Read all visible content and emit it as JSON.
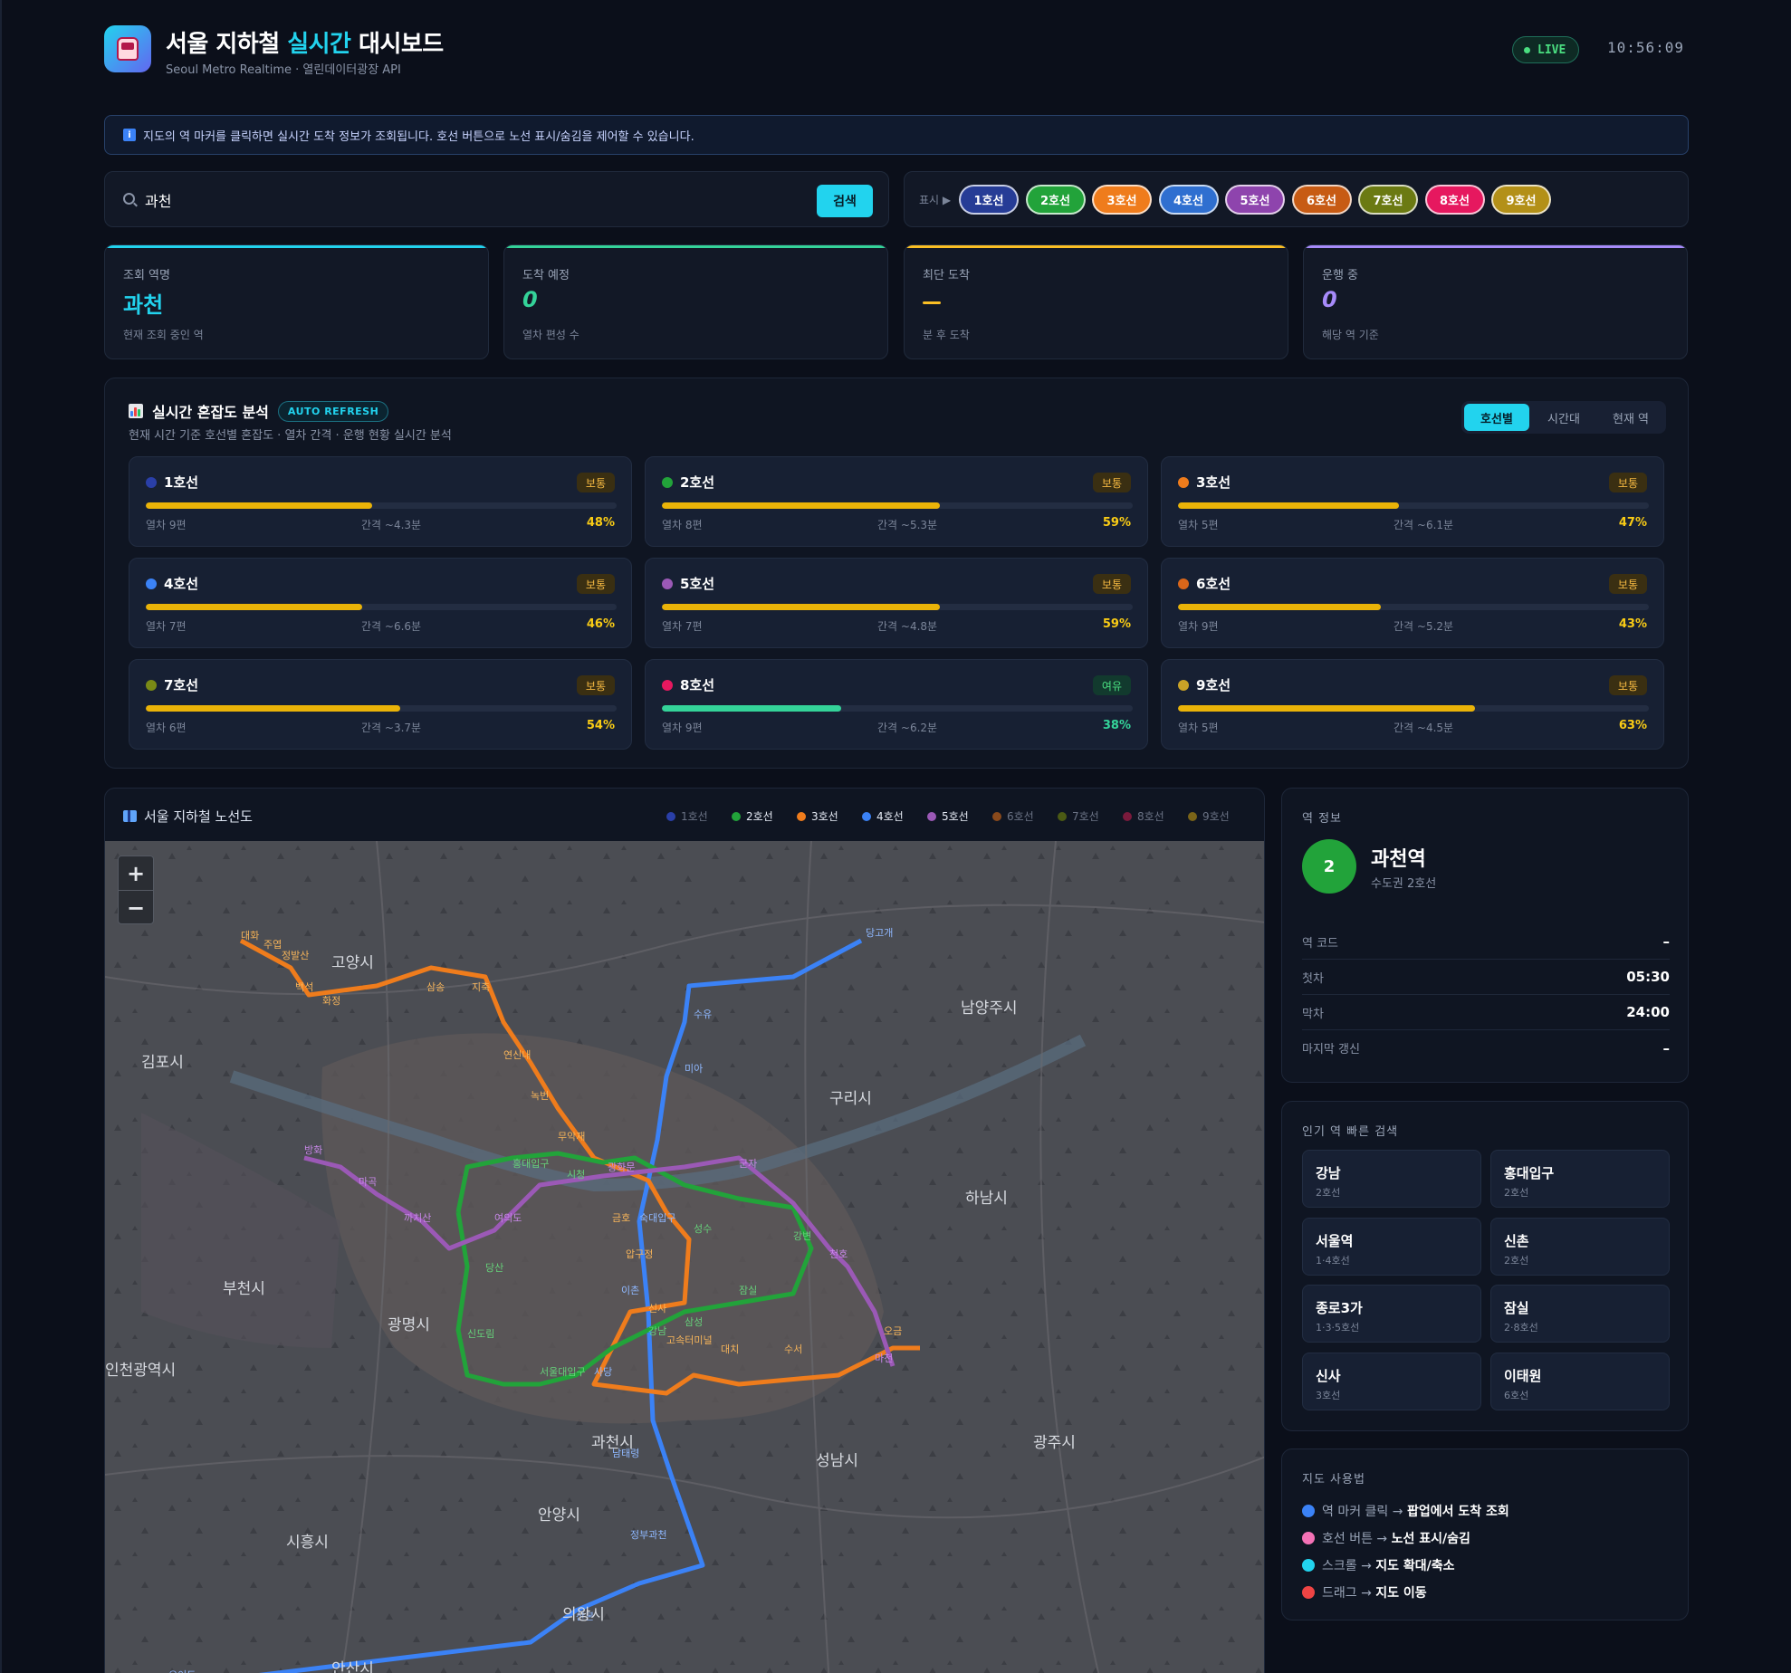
{
  "header": {
    "title_prefix": "서울 지하철 ",
    "title_accent": "실시간",
    "title_suffix": " 대시보드",
    "subtitle": "Seoul Metro Realtime · 열린데이터광장 API",
    "live": "LIVE",
    "clock": "10:56:09"
  },
  "notice": "지도의 역 마커를 클릭하면 실시간 도착 정보가 조회됩니다. 호선 버튼으로 노선 표시/숨김을 제어할 수 있습니다.",
  "search": {
    "value": "과천",
    "button": "검색"
  },
  "line_toggle": {
    "label": "표시 ▶",
    "lines": [
      {
        "label": "1호선",
        "color": "#263c96"
      },
      {
        "label": "2호선",
        "color": "#22a33a"
      },
      {
        "label": "3호선",
        "color": "#ef7c1c"
      },
      {
        "label": "4호선",
        "color": "#2f6fd0"
      },
      {
        "label": "5호선",
        "color": "#8e44ad"
      },
      {
        "label": "6호선",
        "color": "#c75b14"
      },
      {
        "label": "7호선",
        "color": "#6b7a12"
      },
      {
        "label": "8호선",
        "color": "#e6185f"
      },
      {
        "label": "9호선",
        "color": "#b39018"
      }
    ]
  },
  "stats": [
    {
      "label": "조회 역명",
      "value": "과천",
      "sub": "현재 조회 중인 역",
      "color": "#22d3ee"
    },
    {
      "label": "도착 예정",
      "value": "0",
      "sub": "열차 편성 수",
      "color": "#34d399"
    },
    {
      "label": "최단 도착",
      "value": "",
      "sub": "분 후 도착",
      "color": "#fbbf24"
    },
    {
      "label": "운행 중",
      "value": "0",
      "sub": "해당 역 기준",
      "color": "#a78bfa"
    }
  ],
  "congestion": {
    "title": "실시간 혼잡도 분석",
    "badge": "AUTO REFRESH",
    "subtitle": "현재 시간 기준 호선별 혼잡도 · 열차 간격 · 운행 현황 실시간 분석",
    "tabs": [
      "호선별",
      "시간대",
      "현재 역"
    ],
    "items": [
      {
        "name": "1호선",
        "color": "#2a3fa8",
        "status": "보통",
        "trains": "열차 9편",
        "interval": "간격 ~4.3분",
        "pct": 48,
        "pct_label": "48%"
      },
      {
        "name": "2호선",
        "color": "#22a33a",
        "status": "보통",
        "trains": "열차 8편",
        "interval": "간격 ~5.3분",
        "pct": 59,
        "pct_label": "59%"
      },
      {
        "name": "3호선",
        "color": "#ef7c1c",
        "status": "보통",
        "trains": "열차 5편",
        "interval": "간격 ~6.1분",
        "pct": 47,
        "pct_label": "47%"
      },
      {
        "name": "4호선",
        "color": "#3b82f6",
        "status": "보통",
        "trains": "열차 7편",
        "interval": "간격 ~6.6분",
        "pct": 46,
        "pct_label": "46%"
      },
      {
        "name": "5호선",
        "color": "#9b59b6",
        "status": "보통",
        "trains": "열차 7편",
        "interval": "간격 ~4.8분",
        "pct": 59,
        "pct_label": "59%"
      },
      {
        "name": "6호선",
        "color": "#d9661a",
        "status": "보통",
        "trains": "열차 9편",
        "interval": "간격 ~5.2분",
        "pct": 43,
        "pct_label": "43%"
      },
      {
        "name": "7호선",
        "color": "#7a8a16",
        "status": "보통",
        "trains": "열차 6편",
        "interval": "간격 ~3.7분",
        "pct": 54,
        "pct_label": "54%"
      },
      {
        "name": "8호선",
        "color": "#e6185f",
        "status": "여유",
        "trains": "열차 9편",
        "interval": "간격 ~6.2분",
        "pct": 38,
        "pct_label": "38%"
      },
      {
        "name": "9호선",
        "color": "#c9a227",
        "status": "보통",
        "trains": "열차 5편",
        "interval": "간격 ~4.5분",
        "pct": 63,
        "pct_label": "63%"
      }
    ]
  },
  "map": {
    "title": "서울 지하철 노선도",
    "legend": [
      {
        "label": "1호선",
        "color": "#2a3fa8",
        "active": false
      },
      {
        "label": "2호선",
        "color": "#22a33a",
        "active": true
      },
      {
        "label": "3호선",
        "color": "#ef7c1c",
        "active": true
      },
      {
        "label": "4호선",
        "color": "#3b82f6",
        "active": true
      },
      {
        "label": "5호선",
        "color": "#9b59b6",
        "active": true
      },
      {
        "label": "6호선",
        "color": "#8a4a1c",
        "active": false
      },
      {
        "label": "7호선",
        "color": "#4b5a14",
        "active": false
      },
      {
        "label": "8호선",
        "color": "#7a1a3c",
        "active": false
      },
      {
        "label": "9호선",
        "color": "#7a6418",
        "active": false
      }
    ],
    "zoom_in": "+",
    "zoom_out": "−",
    "cities": [
      "고양시",
      "김포시",
      "남양주시",
      "구리시",
      "하남시",
      "부천시",
      "광명시",
      "인천광역시",
      "과천시",
      "성남시",
      "광주시",
      "안양시",
      "시흥시",
      "의왕시",
      "안산시"
    ]
  },
  "station_info": {
    "header": "역 정보",
    "line_number": "2",
    "name": "과천역",
    "sub": "수도권 2호선",
    "rows": [
      {
        "key": "역 코드",
        "value": "–"
      },
      {
        "key": "첫차",
        "value": "05:30"
      },
      {
        "key": "막차",
        "value": "24:00"
      },
      {
        "key": "마지막 갱신",
        "value": "–"
      }
    ]
  },
  "popular": {
    "header": "인기 역 빠른 검색",
    "items": [
      {
        "name": "강남",
        "lines": "2호선"
      },
      {
        "name": "홍대입구",
        "lines": "2호선"
      },
      {
        "name": "서울역",
        "lines": "1·4호선"
      },
      {
        "name": "신촌",
        "lines": "2호선"
      },
      {
        "name": "종로3가",
        "lines": "1·3·5호선"
      },
      {
        "name": "잠실",
        "lines": "2·8호선"
      },
      {
        "name": "신사",
        "lines": "3호선"
      },
      {
        "name": "이태원",
        "lines": "6호선"
      }
    ]
  },
  "guide": {
    "header": "지도 사용법",
    "items": [
      {
        "action": "역 마커 클릭 → ",
        "result": "팝업에서 도착 조회",
        "color": "#3b82f6"
      },
      {
        "action": "호선 버튼 → ",
        "result": "노선 표시/숨김",
        "color": "#f472b6"
      },
      {
        "action": "스크롤 → ",
        "result": "지도 확대/축소",
        "color": "#22d3ee"
      },
      {
        "action": "드래그 → ",
        "result": "지도 이동",
        "color": "#ef4444"
      }
    ]
  }
}
